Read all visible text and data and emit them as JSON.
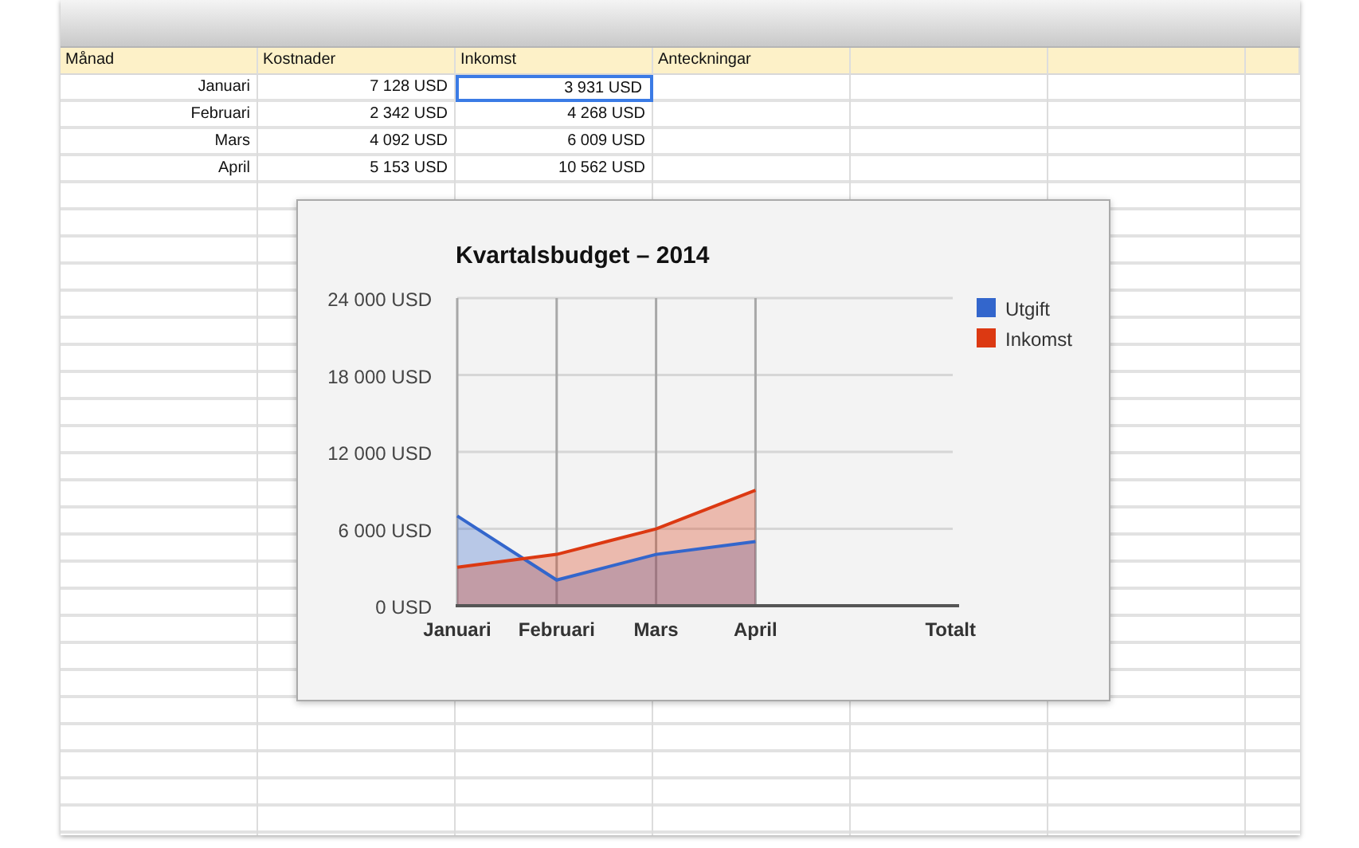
{
  "sheet": {
    "columns": [
      "Månad",
      "Kostnader",
      "Inkomst",
      "Anteckningar"
    ],
    "rows": [
      {
        "cells": [
          {
            "text": "Januari",
            "selected": false
          },
          {
            "text": "7 128 USD",
            "selected": false
          },
          {
            "text": "3 931 USD",
            "selected": true
          }
        ]
      },
      {
        "cells": [
          {
            "text": "Februari",
            "selected": false
          },
          {
            "text": "2 342 USD",
            "selected": false
          },
          {
            "text": "4 268 USD",
            "selected": false
          }
        ]
      },
      {
        "cells": [
          {
            "text": "Mars",
            "selected": false
          },
          {
            "text": "4 092 USD",
            "selected": false
          },
          {
            "text": "6 009 USD",
            "selected": false
          }
        ]
      },
      {
        "cells": [
          {
            "text": "April",
            "selected": false
          },
          {
            "text": "5 153 USD",
            "selected": false
          },
          {
            "text": "10 562 USD",
            "selected": false
          }
        ]
      }
    ]
  },
  "chart": {
    "chart_data": {
      "type": "area",
      "title": "Kvartalsbudget – 2014",
      "categories": [
        "Januari",
        "Februari",
        "Mars",
        "April",
        "Totalt"
      ],
      "series": [
        {
          "name": "Utgift",
          "color": "#3366cc",
          "values": [
            7000,
            2000,
            4000,
            5000,
            null
          ]
        },
        {
          "name": "Inkomst",
          "color": "#dc3912",
          "values": [
            3000,
            4000,
            6000,
            9000,
            null
          ]
        }
      ],
      "ylim": [
        0,
        24000
      ],
      "grid": true,
      "legend": true,
      "yticks": [
        {
          "value": 0,
          "label": "0 USD"
        },
        {
          "value": 6000,
          "label": "6 000 USD"
        },
        {
          "value": 12000,
          "label": "12 000 USD"
        },
        {
          "value": 18000,
          "label": "18 000 USD"
        },
        {
          "value": 24000,
          "label": "24 000 USD"
        }
      ]
    }
  }
}
